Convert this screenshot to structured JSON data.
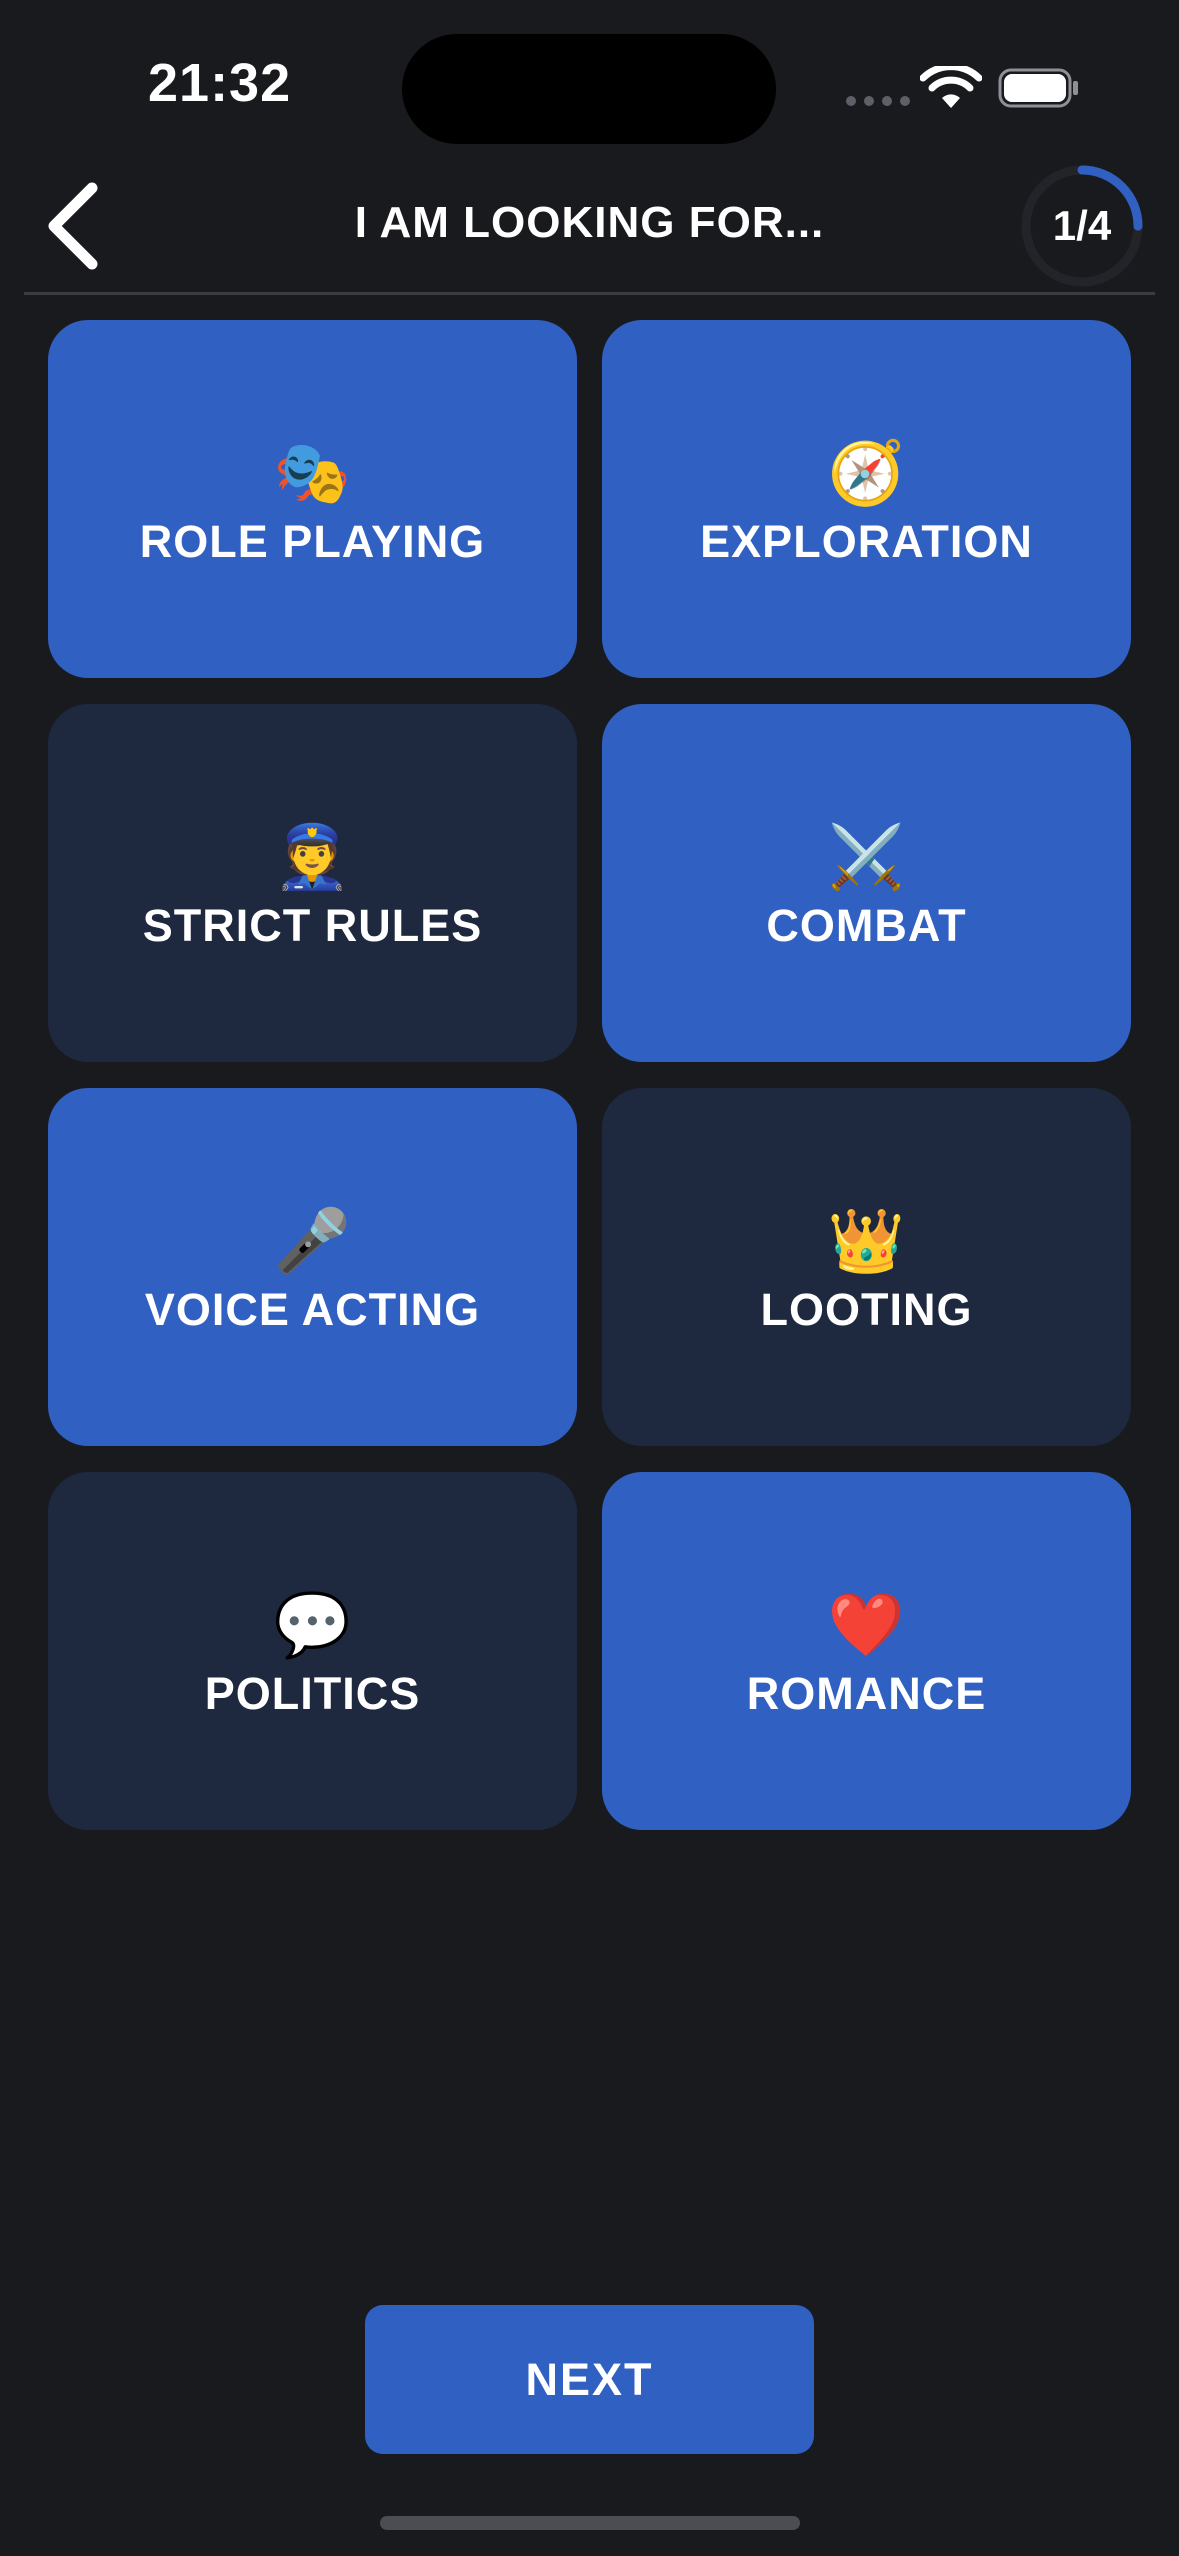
{
  "status_bar": {
    "time": "21:32"
  },
  "header": {
    "title": "I AM LOOKING FOR...",
    "progress_label": "1/4",
    "progress_fraction": 0.25
  },
  "options": [
    {
      "emoji": "🎭",
      "icon_name": "performing-arts-icon",
      "label": "ROLE PLAYING",
      "selected": true
    },
    {
      "emoji": "🧭",
      "icon_name": "compass-icon",
      "label": "EXPLORATION",
      "selected": true
    },
    {
      "emoji": "👮",
      "icon_name": "police-officer-icon",
      "label": "STRICT RULES",
      "selected": false
    },
    {
      "emoji": "⚔️",
      "icon_name": "crossed-swords-icon",
      "label": "COMBAT",
      "selected": true
    },
    {
      "emoji": "🎤",
      "icon_name": "microphone-icon",
      "label": "VOICE ACTING",
      "selected": true
    },
    {
      "emoji": "👑",
      "icon_name": "crown-icon",
      "label": "LOOTING",
      "selected": false
    },
    {
      "emoji": "💬",
      "icon_name": "speech-bubble-icon",
      "label": "POLITICS",
      "selected": false
    },
    {
      "emoji": "❤️",
      "icon_name": "red-heart-icon",
      "label": "ROMANCE",
      "selected": true
    }
  ],
  "footer": {
    "next_label": "NEXT"
  },
  "colors": {
    "background": "#191a1e",
    "selected_tile": "#3060c2",
    "unselected_tile": "#1e2940",
    "accent": "#3060c2"
  }
}
